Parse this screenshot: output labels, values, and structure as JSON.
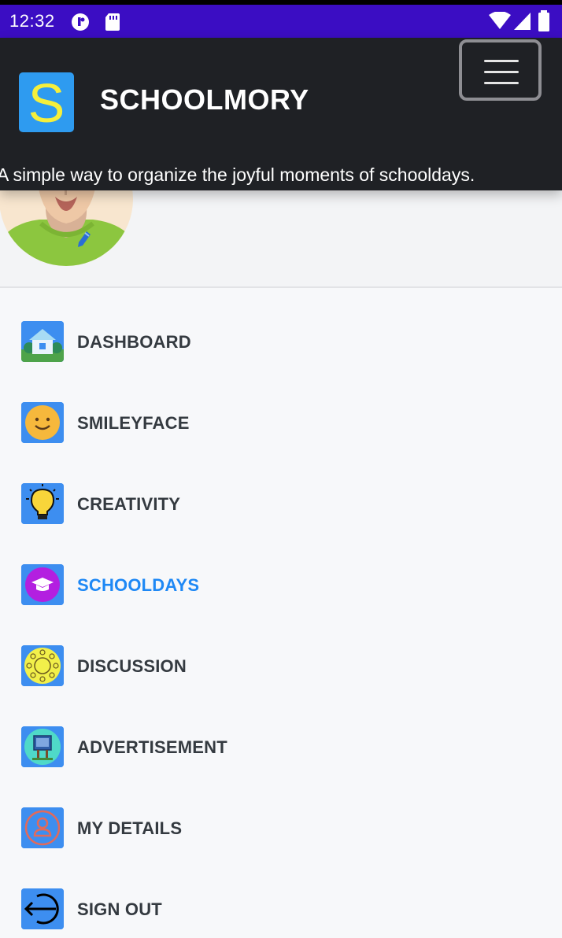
{
  "status_bar": {
    "time": "12:32",
    "icons": [
      "notification-icon",
      "sd-card-icon",
      "wifi-icon",
      "signal-icon",
      "battery-icon"
    ]
  },
  "header": {
    "logo_letter": "S",
    "title": "SCHOOLMORY",
    "tagline": "A simple way to organize the joyful moments of schooldays.",
    "menu_icon": "hamburger-menu-icon"
  },
  "profile": {
    "avatar_icon": "user-avatar",
    "edit_icon": "pencil-icon"
  },
  "nav": {
    "items": [
      {
        "label": "DASHBOARD",
        "icon": "house-icon",
        "active": false
      },
      {
        "label": "SMILEYFACE",
        "icon": "smiley-icon",
        "active": false
      },
      {
        "label": "CREATIVITY",
        "icon": "lightbulb-icon",
        "active": false
      },
      {
        "label": "SCHOOLDAYS",
        "icon": "graduation-cap-icon",
        "active": true
      },
      {
        "label": "DISCUSSION",
        "icon": "discussion-table-icon",
        "active": false
      },
      {
        "label": "ADVERTISEMENT",
        "icon": "billboard-icon",
        "active": false
      },
      {
        "label": "MY DETAILS",
        "icon": "person-icon",
        "active": false
      },
      {
        "label": "SIGN OUT",
        "icon": "sign-out-icon",
        "active": false
      }
    ]
  },
  "colors": {
    "status_bar": "#3b0dc3",
    "header": "#1f2125",
    "accent": "#1e88f5",
    "icon_bg": "#3d8ef0",
    "logo_letter": "#f5ef3c"
  }
}
